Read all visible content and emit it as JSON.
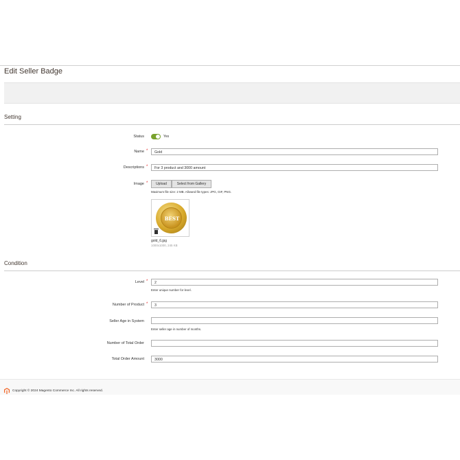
{
  "page": {
    "title": "Edit Seller Badge"
  },
  "sections": {
    "setting": "Setting",
    "condition": "Condition"
  },
  "setting": {
    "status_label": "Status",
    "status_value": "Yes",
    "name_label": "Name",
    "name_value": "Gold",
    "descriptions_label": "Descriptions",
    "descriptions_value": "For 3 product and 3000 amount",
    "image_label": "Image",
    "upload_button": "Upload",
    "gallery_button": "Select from Gallery",
    "upload_note": "Maximum file size: 2 MB. Allowed file types: JPG, GIF, PNG.",
    "badge_text": "BEST",
    "file_name": "gold_6.jpg",
    "file_meta": "1000x1000, 245 KB"
  },
  "condition": {
    "level_label": "Level",
    "level_value": "2",
    "level_note": "Enter unique number for level.",
    "product_label": "Number of Product",
    "product_value": "3",
    "seller_age_label": "Seller Age in System",
    "seller_age_value": "",
    "seller_age_note": "Enter seller age in number of months.",
    "total_order_label": "Number of Total Order",
    "total_order_value": "",
    "total_amount_label": "Total Order Amount",
    "total_amount_value": "3000"
  },
  "footer": {
    "copyright": "Copyright © 2024 Magento Commerce Inc. All rights reserved."
  },
  "colors": {
    "accent_toggle": "#79a22e",
    "required_star": "#e22626",
    "logo_orange": "#f26322"
  }
}
